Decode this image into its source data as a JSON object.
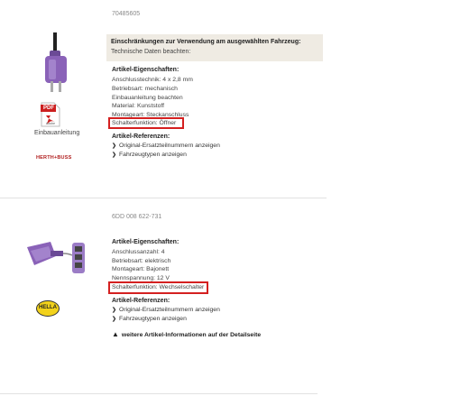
{
  "product1": {
    "article_number": "70485605",
    "restriction": {
      "title": "Einschränkungen zur Verwendung am ausgewählten Fahrzeug:",
      "subtitle": "Technische Daten beachten:"
    },
    "properties_title": "Artikel-Eigenschaften:",
    "properties": [
      "Anschlusstechnik: 4 x 2,8 mm",
      "Betriebsart: mechanisch",
      "Einbauanleitung beachten",
      "Material: Kunststoff",
      "Montageart: Steckanschluss",
      "Schalterfunktion: Öffner"
    ],
    "references_title": "Artikel-Referenzen:",
    "references": [
      "Original-Ersatzteilnummern anzeigen",
      "Fahrzeugtypen anzeigen"
    ],
    "pdf_label": "Einbauanleitung",
    "pdf_icon_text": "PDF",
    "pdf_icon_small": "Adobe",
    "brand_logo": "HERTH+BUSS"
  },
  "product2": {
    "article_number": "6DD 008 622-731",
    "properties_title": "Artikel-Eigenschaften:",
    "properties": [
      "Anschlussanzahl: 4",
      "Betriebsart: elektrisch",
      "Montageart: Bajonett",
      "Nennspannung: 12 V",
      "Schalterfunktion: Wechselschalter"
    ],
    "references_title": "Artikel-Referenzen:",
    "references": [
      "Original-Ersatzteilnummern anzeigen",
      "Fahrzeugtypen anzeigen"
    ],
    "more_info": "weitere Artikel-Informationen auf der Detailseite",
    "brand_logo": "HELLA"
  },
  "colors": {
    "highlight": "#d42020",
    "header_box_bg": "#efebe3",
    "product_purple": "#8a62b8"
  }
}
